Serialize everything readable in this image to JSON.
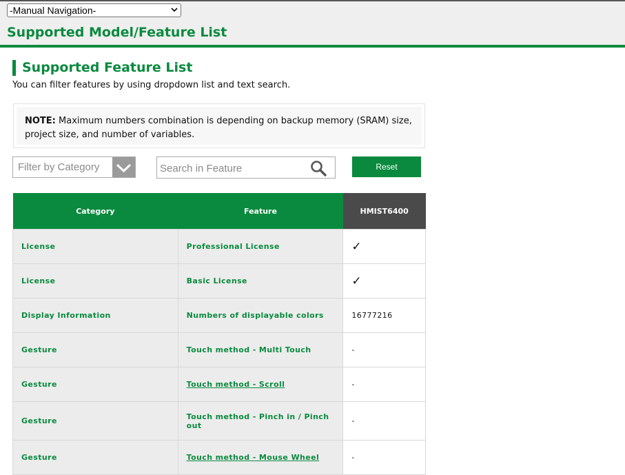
{
  "nav": {
    "selected": "-Manual Navigation-"
  },
  "header": {
    "title": "Supported Model/Feature List"
  },
  "section": {
    "title": "Supported Feature List",
    "intro": "You can filter features by using dropdown list and text search."
  },
  "note": {
    "label": "NOTE:",
    "text": " Maximum numbers combination is depending on backup memory (SRAM) size, project size, and number of variables."
  },
  "filters": {
    "category_placeholder": "Filter by Category",
    "search_placeholder": "Search in Feature",
    "reset_label": "Reset"
  },
  "table": {
    "headers": {
      "category": "Category",
      "feature": "Feature",
      "model": "HMIST6400"
    },
    "rows": [
      {
        "category": "License",
        "feature": "Professional License",
        "value": "✓",
        "feature_link": false
      },
      {
        "category": "License",
        "feature": "Basic License",
        "value": "✓",
        "feature_link": false
      },
      {
        "category": "Display Information",
        "feature": "Numbers of displayable colors",
        "value": "16777216",
        "feature_link": false
      },
      {
        "category": "Gesture",
        "feature": "Touch method - Multi Touch",
        "value": "-",
        "feature_link": false
      },
      {
        "category": "Gesture",
        "feature": "Touch method - Scroll",
        "value": "-",
        "feature_link": true
      },
      {
        "category": "Gesture",
        "feature": "Touch method - Pinch in / Pinch out",
        "value": "-",
        "feature_link": false
      },
      {
        "category": "Gesture",
        "feature": "Touch method - Mouse Wheel",
        "value": "-",
        "feature_link": true
      }
    ]
  },
  "colors": {
    "brand_green": "#0a8a3e",
    "model_header": "#4a4a4a"
  }
}
